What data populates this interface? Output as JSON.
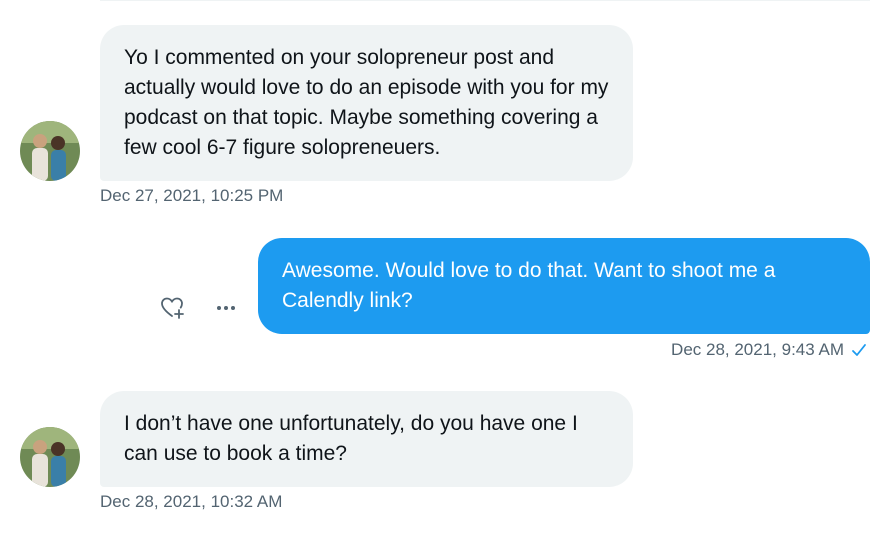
{
  "conversation": {
    "messages": [
      {
        "direction": "incoming",
        "text": "Yo I commented on your solopreneur post and actually would love to do an episode with you for my podcast on that topic. Maybe something covering a few cool 6-7 figure solopreneuers.",
        "timestamp": "Dec 27, 2021, 10:25 PM"
      },
      {
        "direction": "outgoing",
        "text": "Awesome. Would love to do that. Want to shoot me a Calendly link?",
        "timestamp": "Dec 28, 2021, 9:43 AM",
        "status_icon": "check-icon"
      },
      {
        "direction": "incoming",
        "text": "I don’t have one unfortunately, do you have one I can use to book a time?",
        "timestamp": "Dec 28, 2021, 10:32 AM"
      }
    ],
    "message_actions": {
      "react_icon": "heart-plus-icon",
      "more_icon": "more-dots-icon"
    }
  },
  "colors": {
    "incoming_bubble": "#eff3f4",
    "outgoing_bubble": "#1d9bf0",
    "timestamp_text": "#536471",
    "check": "#1d9bf0"
  }
}
